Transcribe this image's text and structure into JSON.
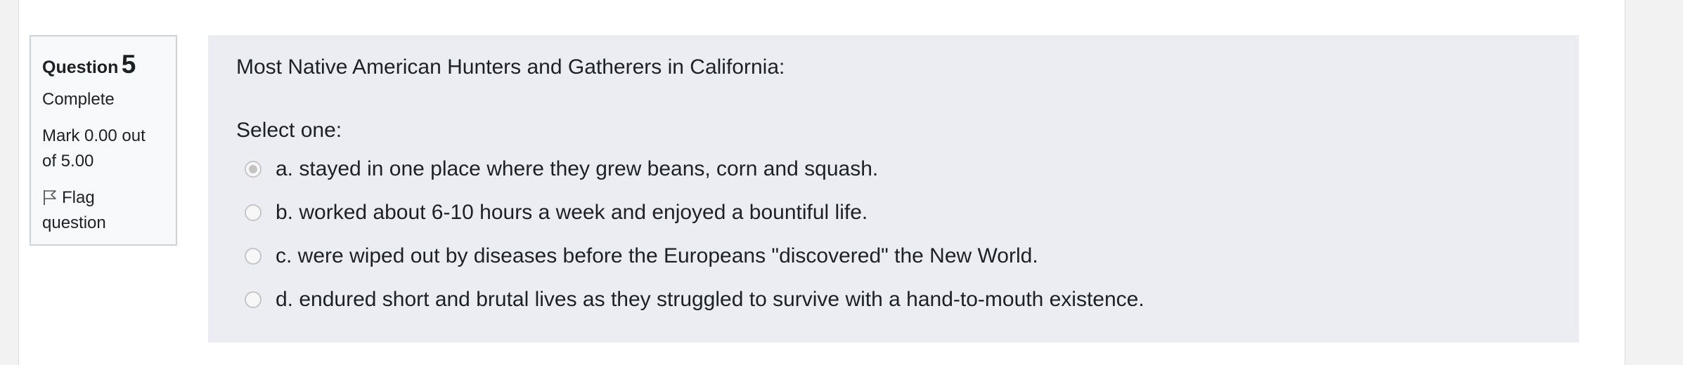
{
  "question_info": {
    "label": "Question",
    "number": "5",
    "state": "Complete",
    "mark_line1": "Mark 0.00 out",
    "mark_line2": "of 5.00",
    "flag_line1": "Flag",
    "flag_line2": "question",
    "flag_icon": "flag-icon"
  },
  "question": {
    "text": "Most Native American Hunters and Gatherers in California:",
    "prompt": "Select one:",
    "answers": [
      {
        "label": "a. stayed in one place where they grew beans, corn and squash.",
        "selected": true
      },
      {
        "label": "b. worked about 6-10 hours a week and enjoyed a bountiful life.",
        "selected": false
      },
      {
        "label": "c. were wiped out by diseases before the Europeans \"discovered\" the New World.",
        "selected": false
      },
      {
        "label": "d. endured short and brutal lives as they struggled to survive with a hand-to-mouth existence.",
        "selected": false
      }
    ]
  }
}
